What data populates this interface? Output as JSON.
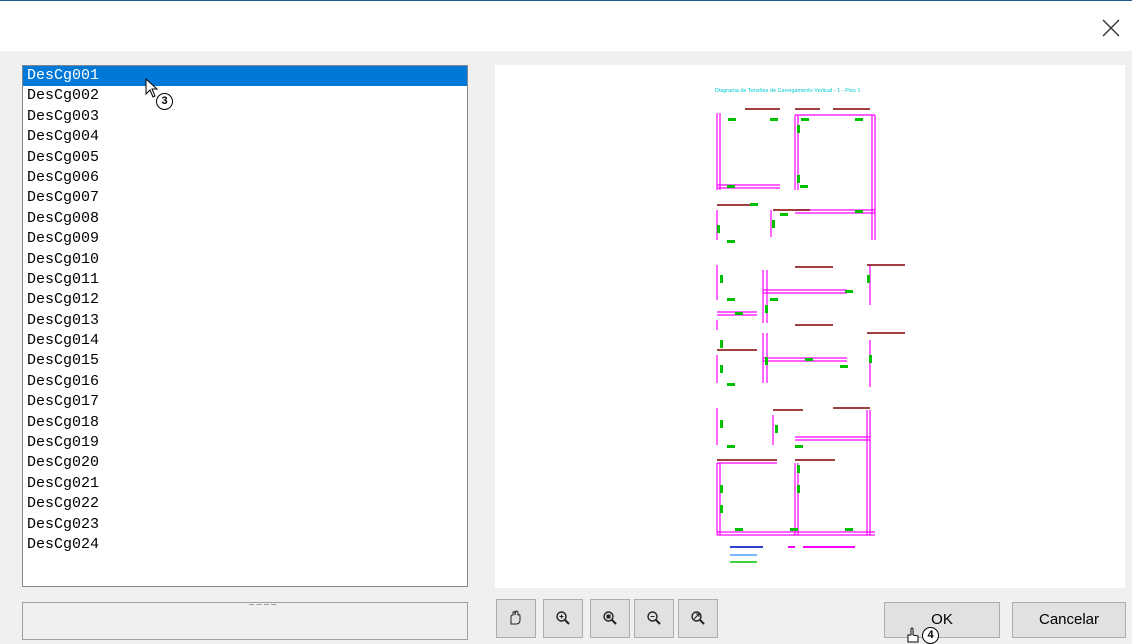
{
  "window": {
    "close_icon": "close-icon"
  },
  "list": {
    "selected_index": 0,
    "items": [
      "DesCg001",
      "DesCg002",
      "DesCg003",
      "DesCg004",
      "DesCg005",
      "DesCg006",
      "DesCg007",
      "DesCg008",
      "DesCg009",
      "DesCg010",
      "DesCg011",
      "DesCg012",
      "DesCg013",
      "DesCg014",
      "DesCg015",
      "DesCg016",
      "DesCg017",
      "DesCg018",
      "DesCg019",
      "DesCg020",
      "DesCg021",
      "DesCg022",
      "DesCg023",
      "DesCg024"
    ]
  },
  "preview": {
    "drawing_title": "Diagrama de Tensões de Carregamento Vertical - 1 - Piso 1"
  },
  "toolbar": {
    "tools": [
      "pan-icon",
      "zoom-in-icon",
      "zoom-window-icon",
      "zoom-out-icon",
      "zoom-extents-icon"
    ]
  },
  "buttons": {
    "ok_label": "OK",
    "cancel_label": "Cancelar"
  },
  "annotations": {
    "step3": "3",
    "step4": "4"
  },
  "colors": {
    "selection": "#0078d7",
    "wall": "#ff00ff",
    "beam": "#800000",
    "support": "#00c000",
    "label": "#00cccc"
  }
}
